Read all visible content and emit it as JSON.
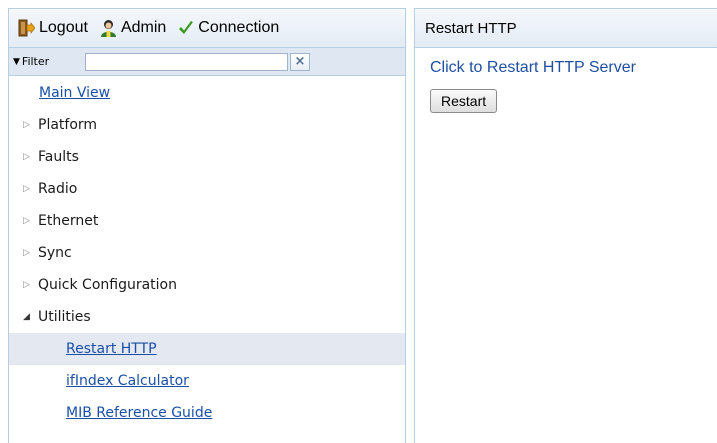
{
  "toolbar": {
    "logout_label": "Logout",
    "admin_label": "Admin",
    "connection_label": "Connection",
    "logout_icon": "logout-door-icon",
    "admin_icon": "user-icon",
    "connection_icon": "checkmark-icon",
    "connection_color": "#3a9a1f"
  },
  "filter": {
    "label": "Filter",
    "value": "",
    "clear_symbol": "×"
  },
  "nav": {
    "main_view": "Main View",
    "collapsed_arrow": "▷",
    "expanded_arrow": "◢",
    "platform": "Platform",
    "faults": "Faults",
    "radio": "Radio",
    "ethernet": "Ethernet",
    "sync": "Sync",
    "quick_configuration": "Quick Configuration",
    "utilities": "Utilities",
    "restart_http": "Restart HTTP",
    "ifindex_calculator": "ifIndex Calculator",
    "mib_reference_guide": "MIB Reference Guide",
    "selected_item": "Restart HTTP"
  },
  "main": {
    "title": "Restart HTTP",
    "instruction": "Click to Restart HTTP Server",
    "restart_button": "Restart"
  },
  "colors": {
    "link": "#1a4fa8",
    "border": "#b7cde2",
    "selected_row": "#e4e9f1"
  }
}
